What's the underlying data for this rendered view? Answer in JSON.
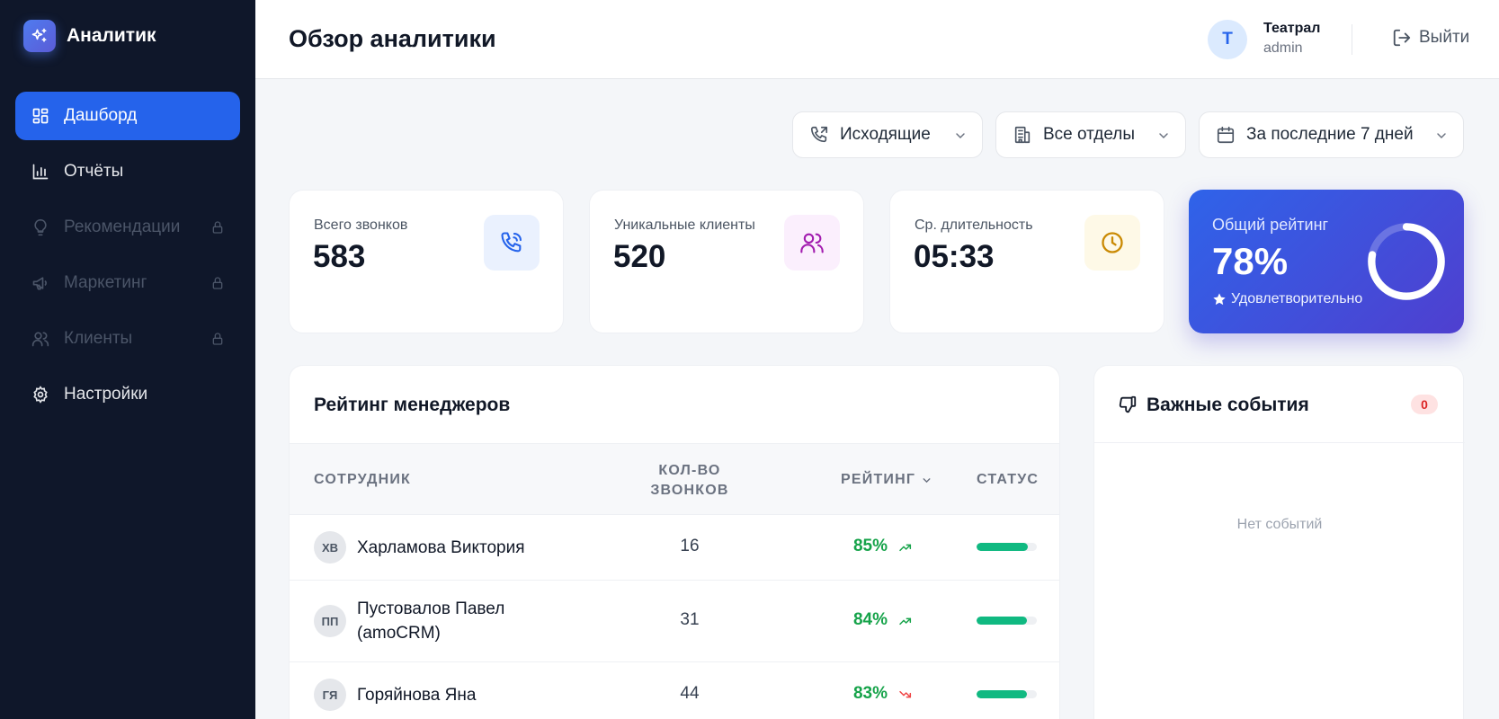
{
  "brand": {
    "name": "Аналитик",
    "icon": "sparkle-icon",
    "accent": "#4f7cf0"
  },
  "sidebar": {
    "items": [
      {
        "label": "Дашборд",
        "icon": "dashboard-grid-icon",
        "active": true,
        "locked": false
      },
      {
        "label": "Отчёты",
        "icon": "bar-chart-icon",
        "active": false,
        "locked": false
      },
      {
        "label": "Рекомендации",
        "icon": "lightbulb-icon",
        "active": false,
        "locked": true
      },
      {
        "label": "Маркетинг",
        "icon": "megaphone-icon",
        "active": false,
        "locked": true
      },
      {
        "label": "Клиенты",
        "icon": "users-icon",
        "active": false,
        "locked": true
      },
      {
        "label": "Настройки",
        "icon": "gear-icon",
        "active": false,
        "locked": false
      }
    ]
  },
  "header": {
    "title": "Обзор аналитики",
    "user": {
      "initial": "Т",
      "name": "Театрал",
      "role": "admin"
    },
    "logout_label": "Выйти"
  },
  "filters": {
    "call_type": "Исходящие",
    "department": "Все отделы",
    "period": "За последние 7 дней"
  },
  "stats": {
    "total_calls": {
      "label": "Всего звонков",
      "value": "583",
      "icon": "phone-icon"
    },
    "unique_clients": {
      "label": "Уникальные клиенты",
      "value": "520",
      "icon": "users-icon"
    },
    "avg_duration": {
      "label": "Ср. длительность",
      "value": "05:33",
      "icon": "clock-icon"
    },
    "overall_rating": {
      "label": "Общий рейтинг",
      "value": "78%",
      "percent": 78,
      "status": "Удовлетворительно",
      "icon": "star-icon"
    }
  },
  "managers": {
    "title": "Рейтинг менеджеров",
    "columns": {
      "employee": "Сотрудник",
      "calls": "Кол-во звонков",
      "rating": "Рейтинг",
      "status": "Статус"
    },
    "rows": [
      {
        "initials": "ХВ",
        "name": "Харламова Виктория",
        "calls": "16",
        "rating": "85%",
        "rating_value": 85,
        "trend": "up"
      },
      {
        "initials": "ПП",
        "name": "Пустовалов Павел (amoCRM)",
        "calls": "31",
        "rating": "84%",
        "rating_value": 84,
        "trend": "up"
      },
      {
        "initials": "ГЯ",
        "name": "Горяйнова Яна",
        "calls": "44",
        "rating": "83%",
        "rating_value": 83,
        "trend": "down"
      }
    ]
  },
  "events": {
    "title": "Важные события",
    "count": "0",
    "empty_text": "Нет событий",
    "icon": "thumbs-down-icon"
  }
}
